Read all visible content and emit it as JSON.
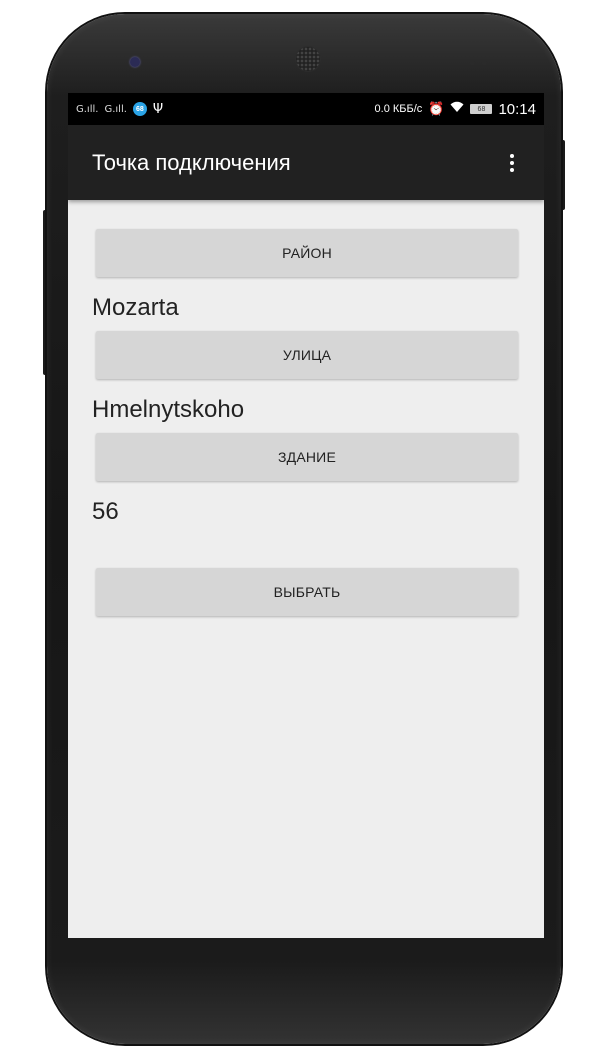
{
  "status_bar": {
    "signal_1": "G.ıll.",
    "signal_2": "G.ıll.",
    "badge": "68",
    "usb_icon": "usb-icon",
    "speed": "0.0 КББ/с",
    "alarm_icon": "alarm-icon",
    "wifi_icon": "wifi-icon",
    "battery": "68",
    "time": "10:14"
  },
  "app_bar": {
    "title": "Точка подключения",
    "menu_icon": "overflow-menu-icon"
  },
  "form": {
    "district_button": "РАЙОН",
    "district_value": "Mozarta",
    "street_button": "УЛИЦА",
    "street_value": "Hmelnytskoho",
    "building_button": "ЗДАНИЕ",
    "building_value": "56",
    "select_button": "ВЫБРАТЬ"
  },
  "colors": {
    "app_bar": "#212121",
    "status_bar": "#000000",
    "background": "#eeeeee",
    "button": "#d6d6d6"
  }
}
